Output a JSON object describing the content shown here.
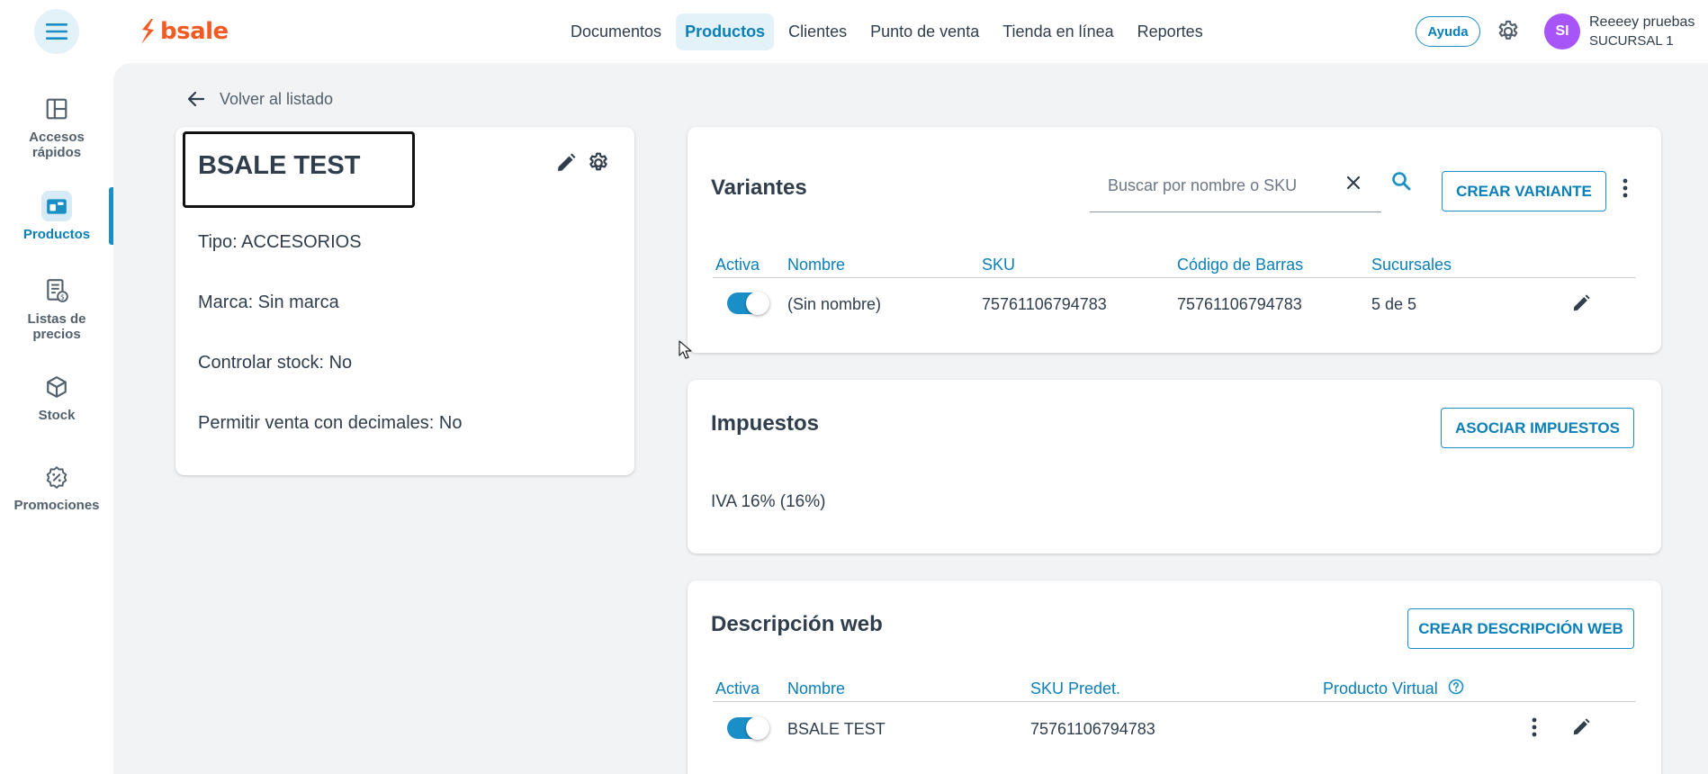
{
  "brand": {
    "logo_text": "bsale",
    "accent": "#f15a22"
  },
  "nav": {
    "items": [
      {
        "label": "Documentos"
      },
      {
        "label": "Productos",
        "active": true
      },
      {
        "label": "Clientes"
      },
      {
        "label": "Punto de venta"
      },
      {
        "label": "Tienda en línea"
      },
      {
        "label": "Reportes"
      }
    ]
  },
  "header": {
    "help_label": "Ayuda",
    "avatar_initials": "SI",
    "user_name": "Reeeey pruebas",
    "branch": "SUCURSAL 1"
  },
  "sidebar": {
    "items": [
      {
        "label": "Accesos rápidos",
        "icon": "layout-icon"
      },
      {
        "label": "Productos",
        "icon": "products-icon",
        "active": true
      },
      {
        "label": "Listas de precios",
        "icon": "price-list-icon"
      },
      {
        "label": "Stock",
        "icon": "box-icon"
      },
      {
        "label": "Promociones",
        "icon": "promo-icon"
      }
    ]
  },
  "back_label": "Volver al listado",
  "product": {
    "name": "BSALE TEST",
    "type": "Tipo: ACCESORIOS",
    "brand": "Marca: Sin marca",
    "stock_control": "Controlar stock: No",
    "decimal_sale": "Permitir venta con decimales: No"
  },
  "variants": {
    "title": "Variantes",
    "search_placeholder": "Buscar por nombre o SKU",
    "create_label": "CREAR VARIANTE",
    "headers": [
      "Activa",
      "Nombre",
      "SKU",
      "Código de Barras",
      "Sucursales"
    ],
    "rows": [
      {
        "active": true,
        "name": "(Sin nombre)",
        "sku": "75761106794783",
        "barcode": "75761106794783",
        "branches": "5 de 5"
      }
    ]
  },
  "taxes": {
    "title": "Impuestos",
    "associate_label": "ASOCIAR IMPUESTOS",
    "items": [
      "IVA 16% (16%)"
    ]
  },
  "web_description": {
    "title": "Descripción web",
    "create_label": "CREAR DESCRIPCIÓN WEB",
    "headers": [
      "Activa",
      "Nombre",
      "SKU Predet.",
      "Producto Virtual"
    ],
    "rows": [
      {
        "active": true,
        "name": "BSALE TEST",
        "sku": "75761106794783"
      }
    ]
  }
}
